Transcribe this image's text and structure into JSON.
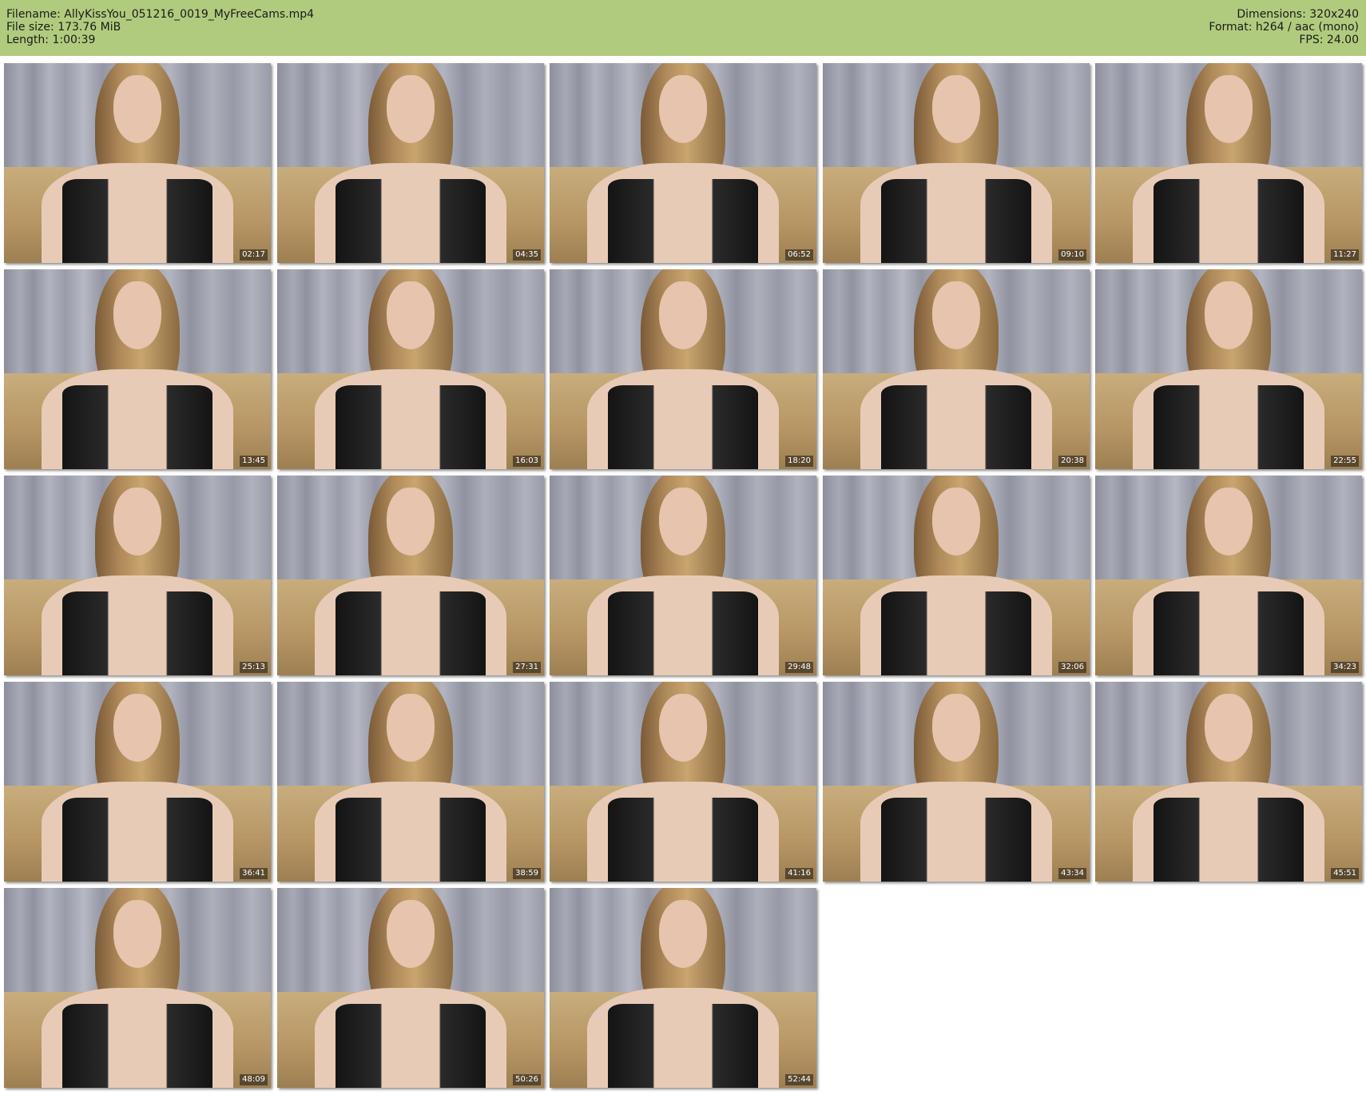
{
  "header": {
    "filename": "Filename: AllyKissYou_051216_0019_MyFreeCams.mp4",
    "file_size": "File size: 173.76 MiB",
    "length": "Length: 1:00:39",
    "dimensions": "Dimensions: 320x240",
    "format": "Format: h264 / aac (mono)",
    "fps": "FPS: 24.00"
  },
  "colors": {
    "header_bg": "#b1cb7e",
    "page_bg": "#ffffff"
  },
  "thumbnails": [
    {
      "timestamp": "02:17"
    },
    {
      "timestamp": "04:35"
    },
    {
      "timestamp": "06:52"
    },
    {
      "timestamp": "09:10"
    },
    {
      "timestamp": "11:27"
    },
    {
      "timestamp": "13:45"
    },
    {
      "timestamp": "16:03"
    },
    {
      "timestamp": "18:20"
    },
    {
      "timestamp": "20:38"
    },
    {
      "timestamp": "22:55"
    },
    {
      "timestamp": "25:13"
    },
    {
      "timestamp": "27:31"
    },
    {
      "timestamp": "29:48"
    },
    {
      "timestamp": "32:06"
    },
    {
      "timestamp": "34:23"
    },
    {
      "timestamp": "36:41"
    },
    {
      "timestamp": "38:59"
    },
    {
      "timestamp": "41:16"
    },
    {
      "timestamp": "43:34"
    },
    {
      "timestamp": "45:51"
    },
    {
      "timestamp": "48:09"
    },
    {
      "timestamp": "50:26"
    },
    {
      "timestamp": "52:44"
    }
  ]
}
